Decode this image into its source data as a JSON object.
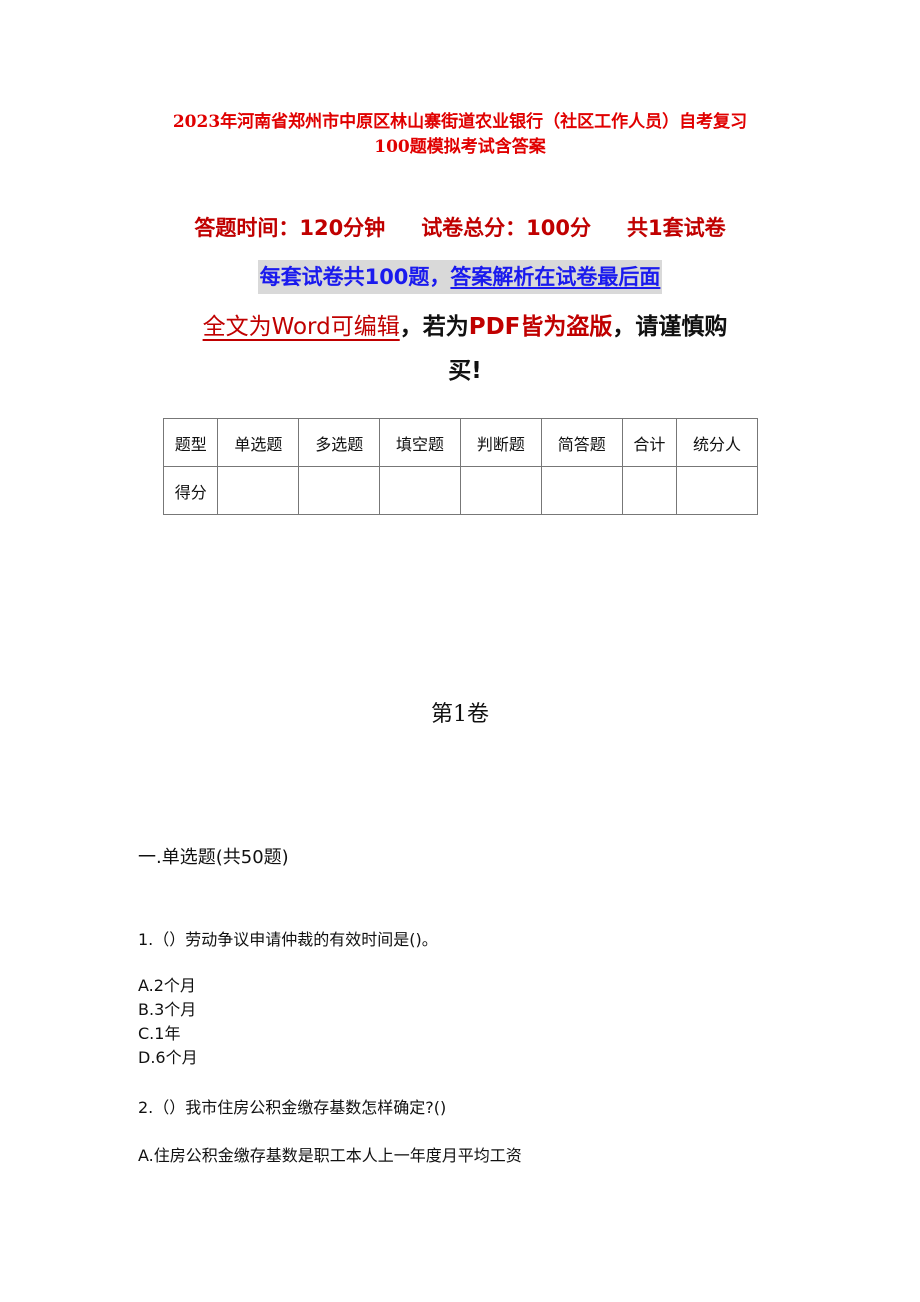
{
  "document": {
    "title_line1": "2023年河南省郑州市中原区林山寨街道农业银行（社区工作人员）自考复习",
    "title_line2": "100题模拟考试含答案",
    "meta": {
      "time": "答题时间：120分钟",
      "total": "试卷总分：100分",
      "sets": "共1套试卷"
    },
    "notice": {
      "part1": "每套试卷共100题，",
      "part2": "答案解析在试卷最后面"
    },
    "warning": {
      "editable": "全文为Word可编辑",
      "comma1": "，若为",
      "pdf": "PDF皆为盗版",
      "rest_line1": "，请谨慎购",
      "rest_line2": "买!"
    },
    "score_table": {
      "header": [
        "题型",
        "单选题",
        "多选题",
        "填空题",
        "判断题",
        "简答题",
        "合计",
        "统分人"
      ],
      "row": [
        "得分",
        "",
        "",
        "",
        "",
        "",
        "",
        ""
      ]
    },
    "volume": "第1卷",
    "section": "一.单选题(共50题)",
    "questions": [
      {
        "text": "1.（）劳动争议申请仲裁的有效时间是()。",
        "options": [
          "A.2个月",
          "B.3个月",
          "C.1年",
          "D.6个月"
        ]
      },
      {
        "text": "2.（）我市住房公积金缴存基数怎样确定?()",
        "options": [
          "A.住房公积金缴存基数是职工本人上一年度月平均工资"
        ]
      }
    ]
  }
}
